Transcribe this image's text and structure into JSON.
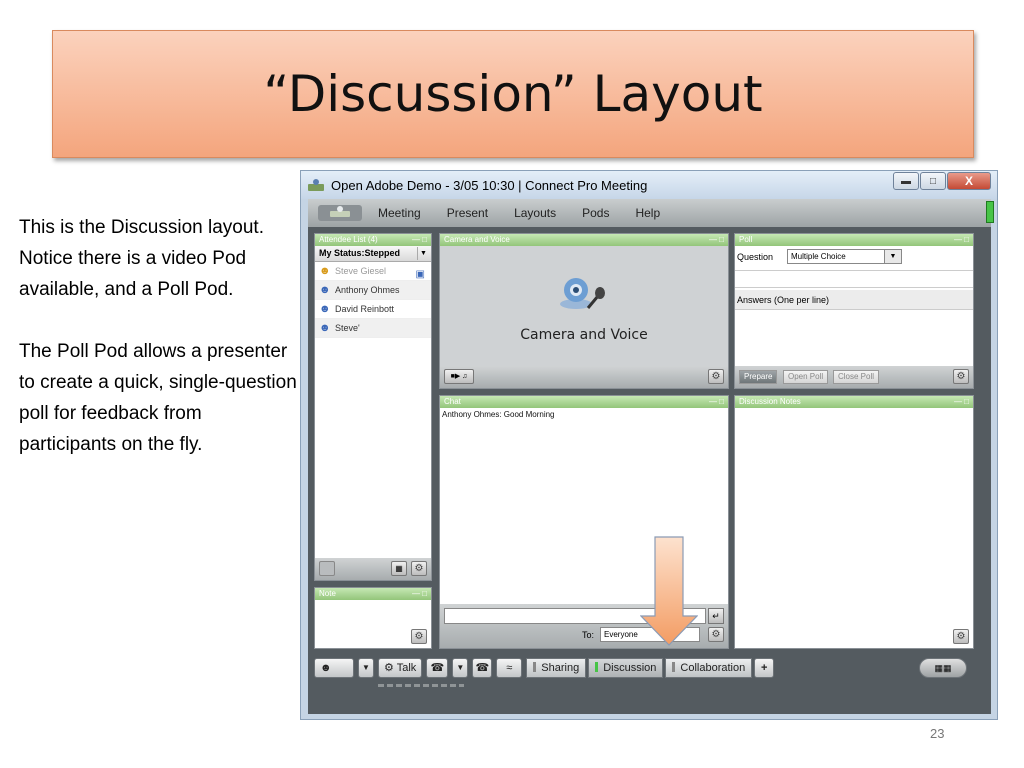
{
  "slide": {
    "title": "“Discussion”  Layout",
    "desc_para1": "This is the Discussion layout. Notice there is a video Pod available, and a Poll Pod.",
    "desc_para2": "The Poll Pod allows a presenter to create a quick, single-question poll for feedback from participants on the fly.",
    "page_number": "23"
  },
  "window": {
    "title": "Open Adobe Demo - 3/05 10:30 | Connect Pro Meeting",
    "menu": [
      "Meeting",
      "Present",
      "Layouts",
      "Pods",
      "Help"
    ]
  },
  "attendee_pod": {
    "title": "Attendee List (4)",
    "status": "My Status:Stepped",
    "attendees": [
      "Steve Giesel",
      "Anthony Ohmes",
      "David Reinbott",
      "Steve'"
    ]
  },
  "camera_pod": {
    "title": "Camera and Voice",
    "label": "Camera and Voice"
  },
  "poll_pod": {
    "title": "Poll",
    "question_label": "Question",
    "question_type": "Multiple Choice",
    "answers_label": "Answers (One per line)",
    "buttons": [
      "Prepare",
      "Open Poll",
      "Close Poll"
    ]
  },
  "chat_pod": {
    "title": "Chat",
    "message": "Anthony Ohmes: Good Morning",
    "to_label": "To:",
    "to_value": "Everyone"
  },
  "notes_pod": {
    "title": "Discussion Notes"
  },
  "note_pod": {
    "title": "Note"
  },
  "toolbar": {
    "talk": "Talk",
    "tabs": [
      "Sharing",
      "Discussion",
      "Collaboration"
    ],
    "add": "+"
  },
  "colors": {
    "title_banner_top": "#fbd2bd",
    "title_banner_bottom": "#f4a57d",
    "pod_header": "#93c57a",
    "arrow": "#f6b98f"
  }
}
